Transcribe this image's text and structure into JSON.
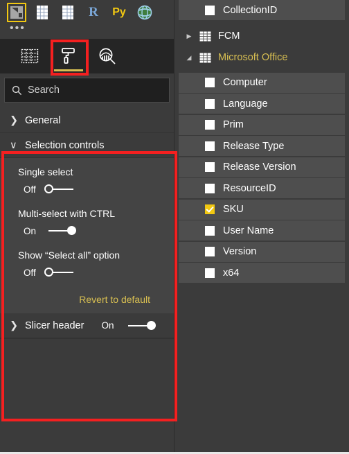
{
  "visualizations": {
    "gallery_icons": [
      {
        "name": "slicer-visual-icon",
        "selected": true
      },
      {
        "name": "table-visual-icon",
        "selected": false
      },
      {
        "name": "matrix-visual-icon",
        "selected": false
      },
      {
        "name": "r-script-visual-icon",
        "label": "R",
        "selected": false
      },
      {
        "name": "python-visual-icon",
        "label": "Py",
        "selected": false
      },
      {
        "name": "arcgis-map-visual-icon",
        "selected": false
      }
    ],
    "more_label": "•••",
    "tabs": [
      {
        "name": "tab-fields",
        "icon": "fields-grid-icon",
        "active": false
      },
      {
        "name": "tab-format",
        "icon": "paint-roller-icon",
        "active": true
      },
      {
        "name": "tab-analytics",
        "icon": "magnifier-chart-icon",
        "active": false
      }
    ]
  },
  "search": {
    "placeholder": "Search",
    "value": "",
    "icon": "search-icon"
  },
  "format_pane": {
    "sections": [
      {
        "label": "General",
        "expanded": false,
        "caret": "❯"
      },
      {
        "label": "Selection controls",
        "expanded": true,
        "caret": "∨",
        "properties": [
          {
            "label": "Single select",
            "state": "Off",
            "on": false
          },
          {
            "label": "Multi-select with CTRL",
            "state": "On",
            "on": true
          },
          {
            "label": "Show “Select all” option",
            "state": "Off",
            "on": false
          }
        ],
        "revert_label": "Revert to default"
      },
      {
        "label": "Slicer header",
        "expanded": false,
        "caret": "❯",
        "state": "On",
        "on": true
      }
    ]
  },
  "fields_pane": {
    "top_field": {
      "label": "CollectionID",
      "checked": false
    },
    "tables": [
      {
        "name": "FCM",
        "expanded": false,
        "selected": false,
        "caret": "▶",
        "fields": []
      },
      {
        "name": "Microsoft Office",
        "expanded": true,
        "selected": true,
        "caret": "◢",
        "fields": [
          {
            "label": "Computer",
            "checked": false
          },
          {
            "label": "Language",
            "checked": false
          },
          {
            "label": "Prim",
            "checked": false
          },
          {
            "label": "Release Type",
            "checked": false
          },
          {
            "label": "Release Version",
            "checked": false
          },
          {
            "label": "ResourceID",
            "checked": false
          },
          {
            "label": "SKU",
            "checked": true
          },
          {
            "label": "User Name",
            "checked": false
          },
          {
            "label": "Version",
            "checked": false
          },
          {
            "label": "x64",
            "checked": false
          }
        ]
      }
    ]
  },
  "annotations": [
    {
      "name": "highlight-format-tab",
      "target": "tab-format"
    },
    {
      "name": "highlight-selection-controls",
      "target": "section-selection-controls"
    }
  ],
  "colors": {
    "accent_yellow": "#f2c811",
    "link_gold": "#d8bf52",
    "annotation_red": "#f42020",
    "pane_bg": "#3b3b3b",
    "section_bg": "#444444",
    "row_bg": "#4e4e4e",
    "tabs_bg": "#252525"
  }
}
